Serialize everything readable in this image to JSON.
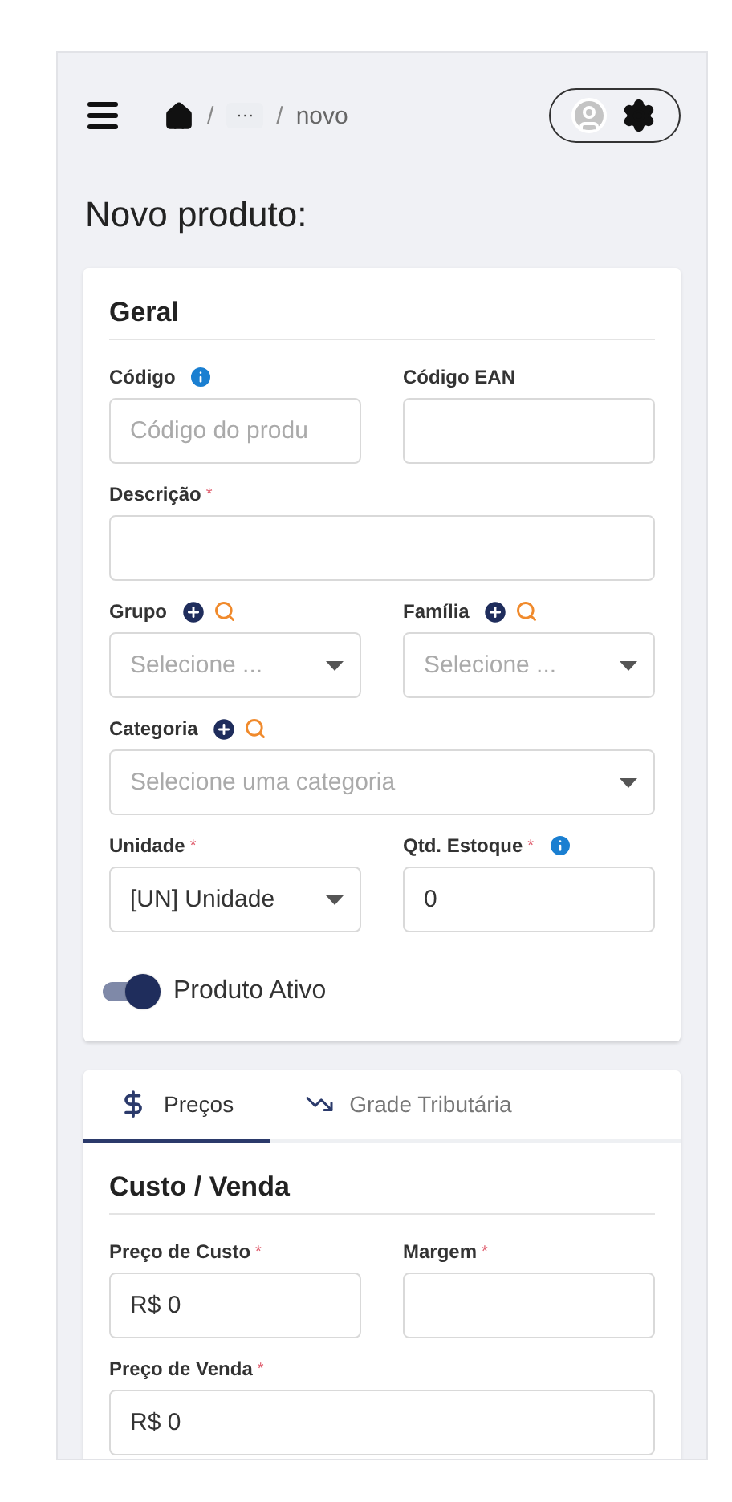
{
  "header": {
    "breadcrumb": [
      {
        "kind": "home"
      },
      {
        "kind": "more",
        "separator": "/",
        "label": "···"
      },
      {
        "kind": "text",
        "separator": "/",
        "label": "novo"
      }
    ]
  },
  "title": "Novo produto:",
  "general": {
    "title": "Geral",
    "rows": [
      [
        {
          "label": "Código",
          "info": true,
          "kind": "text",
          "placeholder": "Código do produ"
        },
        {
          "label": "Código EAN",
          "kind": "text"
        }
      ],
      [
        {
          "label": "Descrição",
          "mark": "*",
          "kind": "text"
        }
      ],
      [
        {
          "label": "Grupo",
          "actions": true,
          "kind": "select",
          "placeholder": "Selecione ..."
        },
        {
          "label": "Família",
          "actions": true,
          "kind": "select",
          "placeholder": "Selecione ..."
        }
      ],
      [
        {
          "label": "Categoria",
          "actions": true,
          "kind": "select",
          "placeholder": "Selecione uma categoria"
        }
      ],
      [
        {
          "label": "Unidade",
          "mark": "*",
          "kind": "select",
          "value": "[UN] Unidade"
        },
        {
          "label": "Qtd. Estoque",
          "mark": "*",
          "info": true,
          "kind": "text",
          "value": "0"
        }
      ]
    ],
    "toggle": {
      "label": "Produto Ativo",
      "on": true
    }
  },
  "tabs": [
    {
      "label": "Preços",
      "kind": "prices",
      "selected": true
    },
    {
      "label": "Grade Tributária",
      "kind": "taxes",
      "selected": false
    }
  ],
  "pricing": {
    "title": "Custo / Venda",
    "rows": [
      [
        {
          "label": "Preço de Custo",
          "mark": "*",
          "kind": "text",
          "value": "R$ 0"
        },
        {
          "label": "Margem",
          "mark": "*",
          "kind": "text"
        }
      ],
      [
        {
          "label": "Preço de Venda",
          "mark": "*",
          "kind": "text",
          "value": "R$ 0"
        }
      ]
    ]
  }
}
